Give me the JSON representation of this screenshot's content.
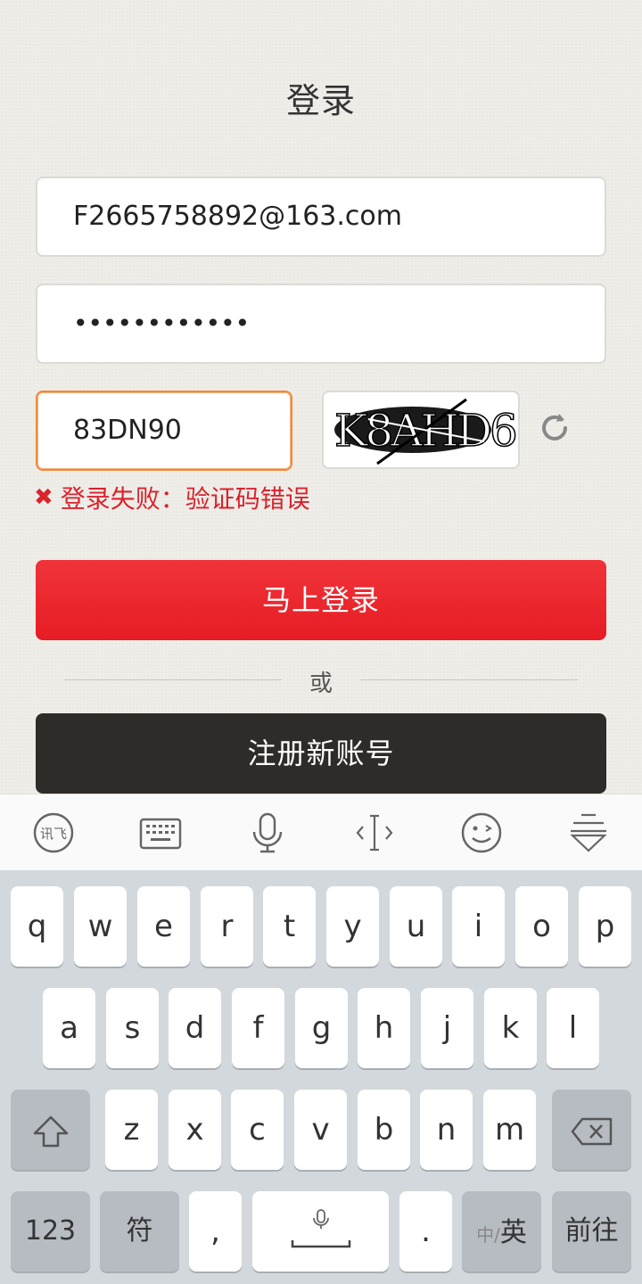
{
  "page": {
    "title": "登录"
  },
  "form": {
    "account_value": "F2665758892@163.com",
    "password_value": "••••••••••••",
    "captcha_value": "83DN90",
    "captcha_image_text": "K8AHD6",
    "error_icon": "✖",
    "error_text": "登录失败：验证码错误"
  },
  "buttons": {
    "login": "马上登录",
    "or": "或",
    "register": "注册新账号"
  },
  "keyboard": {
    "toolbar_icons": [
      "ifly-logo-icon",
      "keyboard-icon",
      "microphone-icon",
      "cursor-icon",
      "emoji-icon",
      "collapse-keyboard-icon"
    ],
    "row1": [
      "q",
      "w",
      "e",
      "r",
      "t",
      "y",
      "u",
      "i",
      "o",
      "p"
    ],
    "row2": [
      "a",
      "s",
      "d",
      "f",
      "g",
      "h",
      "j",
      "k",
      "l"
    ],
    "row3": [
      "z",
      "x",
      "c",
      "v",
      "b",
      "n",
      "m"
    ],
    "bottom": {
      "num": "123",
      "symbol": "符",
      "comma": ",",
      "period": ".",
      "lang_small": "中/",
      "lang_main": "英",
      "go": "前往"
    }
  },
  "colors": {
    "primary_red": "#e71c24",
    "register_dark": "#2f2b29",
    "error_red": "#d9232d",
    "focus_orange": "#ef8a3a"
  }
}
